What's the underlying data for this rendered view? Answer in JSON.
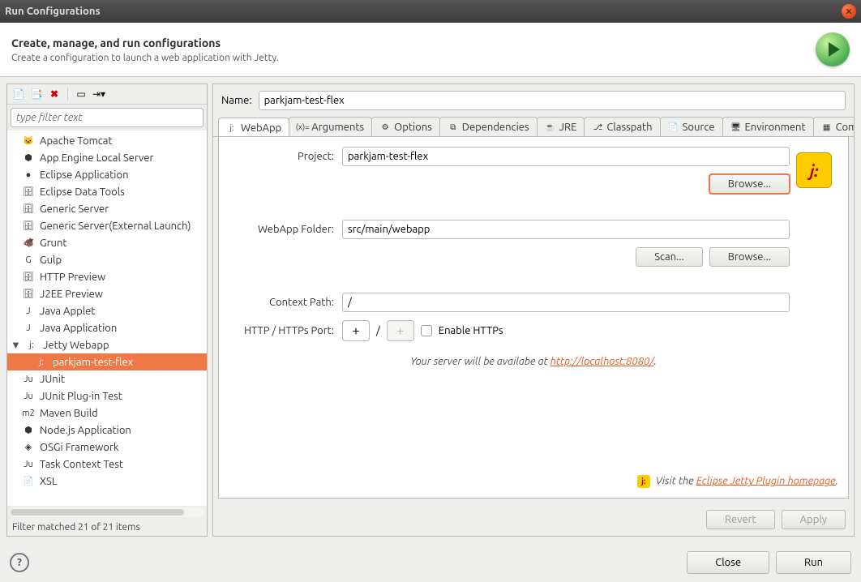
{
  "titlebar": {
    "title": "Run Configurations"
  },
  "header": {
    "title": "Create, manage, and run configurations",
    "subtitle": "Create a configuration to launch a web application with Jetty."
  },
  "filter": {
    "placeholder": "type filter text"
  },
  "tree": {
    "items": [
      {
        "label": "Apache Tomcat",
        "icon": "🐱"
      },
      {
        "label": "App Engine Local Server",
        "icon": "⬢"
      },
      {
        "label": "Eclipse Application",
        "icon": "●"
      },
      {
        "label": "Eclipse Data Tools",
        "icon": "🗄"
      },
      {
        "label": "Generic Server",
        "icon": "🗄"
      },
      {
        "label": "Generic Server(External Launch)",
        "icon": "🗄"
      },
      {
        "label": "Grunt",
        "icon": "🐗"
      },
      {
        "label": "Gulp",
        "icon": "G"
      },
      {
        "label": "HTTP Preview",
        "icon": "🗄"
      },
      {
        "label": "J2EE Preview",
        "icon": "🗄"
      },
      {
        "label": "Java Applet",
        "icon": "J"
      },
      {
        "label": "Java Application",
        "icon": "J"
      },
      {
        "label": "Jetty Webapp",
        "icon": "j:",
        "expandable": true,
        "expanded": true,
        "children": [
          {
            "label": "parkjam-test-flex",
            "icon": "j:",
            "selected": true
          }
        ]
      },
      {
        "label": "JUnit",
        "icon": "Ju"
      },
      {
        "label": "JUnit Plug-in Test",
        "icon": "Ju"
      },
      {
        "label": "Maven Build",
        "icon": "m2"
      },
      {
        "label": "Node.js Application",
        "icon": "⬢"
      },
      {
        "label": "OSGi Framework",
        "icon": "◈"
      },
      {
        "label": "Task Context Test",
        "icon": "Ju"
      },
      {
        "label": "XSL",
        "icon": "📄"
      }
    ],
    "status": "Filter matched 21 of 21 items"
  },
  "name": {
    "label": "Name:",
    "value": "parkjam-test-flex"
  },
  "tabs": [
    {
      "label": "WebApp",
      "active": true
    },
    {
      "label": "Arguments"
    },
    {
      "label": "Options"
    },
    {
      "label": "Dependencies"
    },
    {
      "label": "JRE"
    },
    {
      "label": "Classpath"
    },
    {
      "label": "Source"
    },
    {
      "label": "Environment"
    },
    {
      "label": "Common"
    }
  ],
  "webapp": {
    "project": {
      "label": "Project:",
      "value": "parkjam-test-flex",
      "browse": "Browse..."
    },
    "folder": {
      "label": "WebApp Folder:",
      "value": "src/main/webapp",
      "scan": "Scan...",
      "browse": "Browse..."
    },
    "context": {
      "label": "Context Path:",
      "value": "/"
    },
    "port": {
      "label": "HTTP / HTTPs Port:",
      "sep": "/",
      "enable_https": "Enable HTTPs"
    },
    "server_msg_prefix": "Your server will be availabe at ",
    "server_url": "http://localhost:8080/",
    "footer_prefix": "Visit the ",
    "footer_link": "Eclipse Jetty Plugin homepage",
    "footer_suffix": "."
  },
  "actions": {
    "revert": "Revert",
    "apply": "Apply"
  },
  "dialog": {
    "close": "Close",
    "run": "Run"
  }
}
